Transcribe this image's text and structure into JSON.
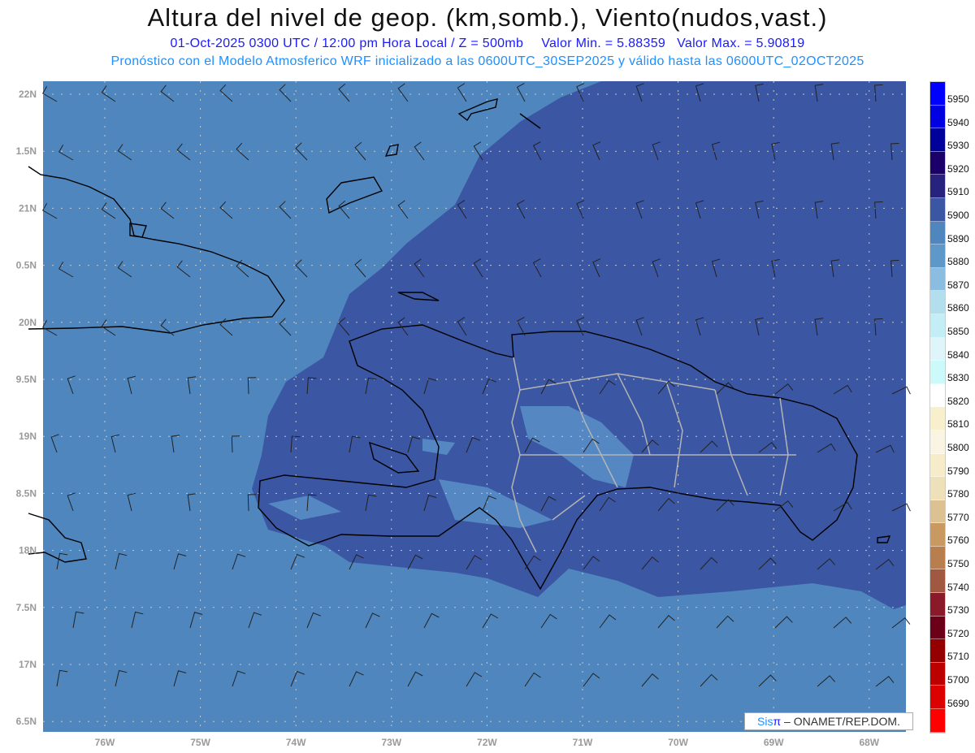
{
  "header": {
    "title": "Altura del nivel de geop. (km,somb.), Viento(nudos,vast.)",
    "date_line": "01-Oct-2025  0300 UTC / 12:00 pm Hora Local / Z = 500mb",
    "min_value": "Valor Min. = 5.88359",
    "max_value": "Valor Max. = 5.90819",
    "model_line": "Pronóstico con el Modelo Atmosferico WRF inicializado a las 0600UTC_30SEP2025 y válido hasta las  0600UTC_02OCT2025"
  },
  "map": {
    "lat_labels": [
      "22N",
      "1.5N",
      "21N",
      "0.5N",
      "20N",
      "9.5N",
      "19N",
      "8.5N",
      "18N",
      "7.5N",
      "17N",
      "6.5N"
    ],
    "lon_labels": [
      "76W",
      "75W",
      "74W",
      "73W",
      "72W",
      "71W",
      "70W",
      "69W",
      "68W"
    ],
    "colors": {
      "light_fill": "#4f86be",
      "dark_fill": "#3b56a2",
      "coast": "#000000",
      "borders": "#b4b4b4"
    }
  },
  "legend": {
    "labels": [
      "5950",
      "5940",
      "5930",
      "5920",
      "5910",
      "5900",
      "5890",
      "5880",
      "5870",
      "5860",
      "5850",
      "5840",
      "5830",
      "5820",
      "5810",
      "5800",
      "5790",
      "5780",
      "5770",
      "5760",
      "5750",
      "5740",
      "5730",
      "5720",
      "5710",
      "5700",
      "5690"
    ],
    "colors": [
      "#0000ff",
      "#0000e0",
      "#00009a",
      "#1a0068",
      "#27227e",
      "#3b56a2",
      "#4f86be",
      "#5d98c9",
      "#8abde0",
      "#b2deee",
      "#c4eef6",
      "#def6fa",
      "#ccfafa",
      "#ffffff",
      "#f8f0cc",
      "#faf4e2",
      "#f6ecca",
      "#eee0b8",
      "#dcc292",
      "#c89a62",
      "#b87e4e",
      "#a05840",
      "#8a1a2a",
      "#6c0018",
      "#940000",
      "#bc0000",
      "#dc0000",
      "#ff0000"
    ]
  },
  "credit": {
    "sis": "Sis",
    "pi": "π",
    "rest": " –  ONAMET/REP.DOM."
  }
}
